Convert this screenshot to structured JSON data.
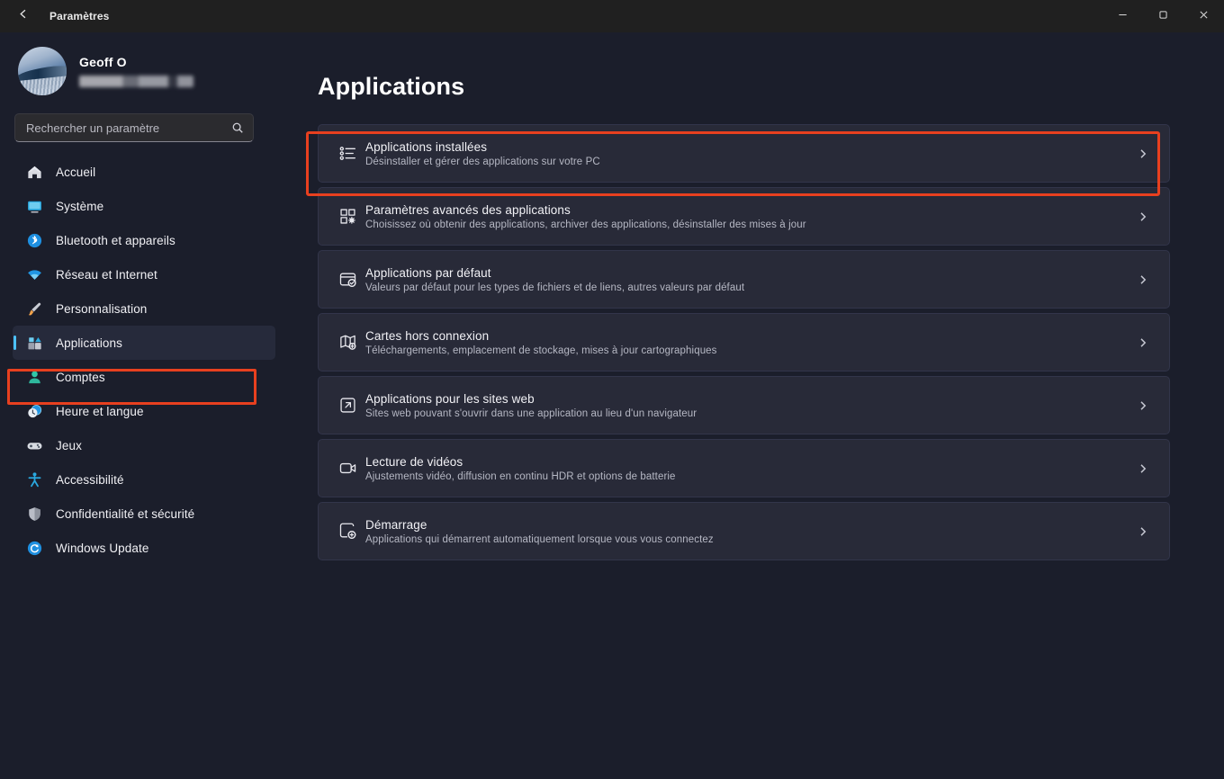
{
  "window": {
    "title": "Paramètres",
    "back_icon": "arrow-left-icon",
    "controls": {
      "minimize": "—",
      "maximize": "❐",
      "close": "✕"
    }
  },
  "account": {
    "name": "Geoff O",
    "email_redacted": true
  },
  "search": {
    "placeholder": "Rechercher un paramètre",
    "value": "",
    "icon": "search-icon"
  },
  "sidebar": {
    "items": [
      {
        "label": "Accueil",
        "icon": "home-icon",
        "selected": false
      },
      {
        "label": "Système",
        "icon": "display-icon",
        "selected": false
      },
      {
        "label": "Bluetooth et appareils",
        "icon": "bluetooth-icon",
        "selected": false
      },
      {
        "label": "Réseau et Internet",
        "icon": "wifi-icon",
        "selected": false
      },
      {
        "label": "Personnalisation",
        "icon": "brush-icon",
        "selected": false
      },
      {
        "label": "Applications",
        "icon": "apps-icon",
        "selected": true
      },
      {
        "label": "Comptes",
        "icon": "person-icon",
        "selected": false
      },
      {
        "label": "Heure et langue",
        "icon": "clock-globe-icon",
        "selected": false
      },
      {
        "label": "Jeux",
        "icon": "gamepad-icon",
        "selected": false
      },
      {
        "label": "Accessibilité",
        "icon": "accessibility-icon",
        "selected": false
      },
      {
        "label": "Confidentialité et sécurité",
        "icon": "shield-icon",
        "selected": false
      },
      {
        "label": "Windows Update",
        "icon": "update-icon",
        "selected": false
      }
    ]
  },
  "main": {
    "title": "Applications",
    "cards": [
      {
        "title": "Applications installées",
        "subtitle": "Désinstaller et gérer des applications sur votre PC",
        "icon": "list-bullets-icon",
        "chevron": "chevron-right-icon",
        "highlighted": true
      },
      {
        "title": "Paramètres avancés des applications",
        "subtitle": "Choisissez où obtenir des applications, archiver des applications, désinstaller des mises à jour",
        "icon": "app-settings-icon",
        "chevron": "chevron-right-icon",
        "highlighted": false
      },
      {
        "title": "Applications par défaut",
        "subtitle": "Valeurs par défaut pour les types de fichiers et de liens, autres valeurs par défaut",
        "icon": "default-apps-icon",
        "chevron": "chevron-right-icon",
        "highlighted": false
      },
      {
        "title": "Cartes hors connexion",
        "subtitle": "Téléchargements, emplacement de stockage, mises à jour cartographiques",
        "icon": "map-icon",
        "chevron": "chevron-right-icon",
        "highlighted": false
      },
      {
        "title": "Applications pour les sites web",
        "subtitle": "Sites web pouvant s'ouvrir dans une application au lieu d'un navigateur",
        "icon": "external-link-icon",
        "chevron": "chevron-right-icon",
        "highlighted": false
      },
      {
        "title": "Lecture de vidéos",
        "subtitle": "Ajustements vidéo, diffusion en continu HDR et options de batterie",
        "icon": "video-icon",
        "chevron": "chevron-right-icon",
        "highlighted": false
      },
      {
        "title": "Démarrage",
        "subtitle": "Applications qui démarrent automatiquement lorsque vous vous connectez",
        "icon": "startup-icon",
        "chevron": "chevron-right-icon",
        "highlighted": false
      }
    ]
  },
  "annotations": {
    "highlight_color": "#e8401f",
    "targets": [
      "sidebar-item-applications",
      "card-applications-installees"
    ]
  },
  "colors": {
    "accent": "#4cc2ff",
    "page_background": "#1b1e2b",
    "card_background": "#282a38",
    "titlebar_background": "#202020"
  }
}
